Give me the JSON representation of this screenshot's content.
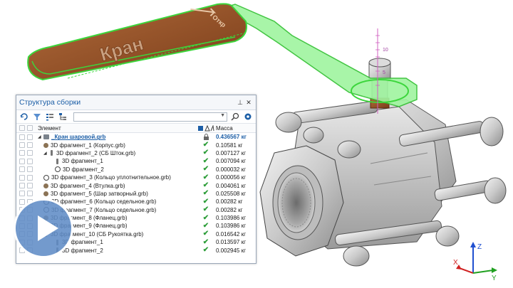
{
  "model": {
    "handle_text": "Кран",
    "arrow_text": "Откр",
    "ruler_labels": [
      "10",
      "5"
    ]
  },
  "panel": {
    "title": "Структура сборки",
    "pin_icon": "pin-icon",
    "close_icon": "close-icon",
    "toolbar_icons": [
      "refresh-icon",
      "filter-icon",
      "list-icon",
      "tree-icon"
    ],
    "filter_value": "",
    "columns": {
      "element": "Элемент",
      "mass": "Масса"
    },
    "root": {
      "name": "_Кран шаровой.grb",
      "mass": "0.436567 кг"
    },
    "rows": [
      {
        "level": 1,
        "icon": "part",
        "name": "3D фрагмент_1 (Корпус.grb)",
        "mass": "0.10581 кг"
      },
      {
        "level": 1,
        "icon": "pin",
        "expanded": true,
        "name": "3D фрагмент_2 (СБ Шток.grb)",
        "mass": "0.007127 кг"
      },
      {
        "level": 2,
        "icon": "pin",
        "name": "3D фрагмент_1",
        "mass": "0.007094 кг"
      },
      {
        "level": 2,
        "icon": "ring",
        "name": "3D фрагмент_2",
        "mass": "0.000032 кг"
      },
      {
        "level": 1,
        "icon": "ring",
        "name": "3D фрагмент_3 (Кольцо уплотнительное.grb)",
        "mass": "0.000056 кг"
      },
      {
        "level": 1,
        "icon": "part",
        "name": "3D фрагмент_4 (Втулка.grb)",
        "mass": "0.004061 кг"
      },
      {
        "level": 1,
        "icon": "part",
        "name": "3D фрагмент_5 (Шар затворный.grb)",
        "mass": "0.025508 кг"
      },
      {
        "level": 1,
        "icon": "ring",
        "name": "3D фрагмент_6 (Кольцо седельное.grb)",
        "mass": "0.00282 кг"
      },
      {
        "level": 1,
        "icon": "ring",
        "name": "3D фрагмент_7 (Кольцо седельное.grb)",
        "mass": "0.00282 кг"
      },
      {
        "level": 1,
        "icon": "part",
        "name": "3D фрагмент_8 (Фланец.grb)",
        "mass": "0.103986 кг"
      },
      {
        "level": 1,
        "icon": "part",
        "name": "3D фрагмент_9 (Фланец.grb)",
        "mass": "0.103986 кг"
      },
      {
        "level": 1,
        "icon": "pin",
        "name": "3D фрагмент_10 (СБ Рукоятка.grb)",
        "mass": "0.016542 кг"
      },
      {
        "level": 2,
        "icon": "pin",
        "name": "3D фрагмент_1",
        "mass": "0.013597 кг"
      },
      {
        "level": 2,
        "icon": "pin",
        "name": "3D фрагмент_2",
        "mass": "0.002945 кг"
      }
    ]
  },
  "axes": {
    "z": "Z",
    "x": "X",
    "y": "Y"
  },
  "colors": {
    "accent": "#1d5fa7",
    "highlight": "#3cd63c",
    "play": "#608cc6",
    "check": "#2e9e3a"
  },
  "play_icon": "play-icon"
}
